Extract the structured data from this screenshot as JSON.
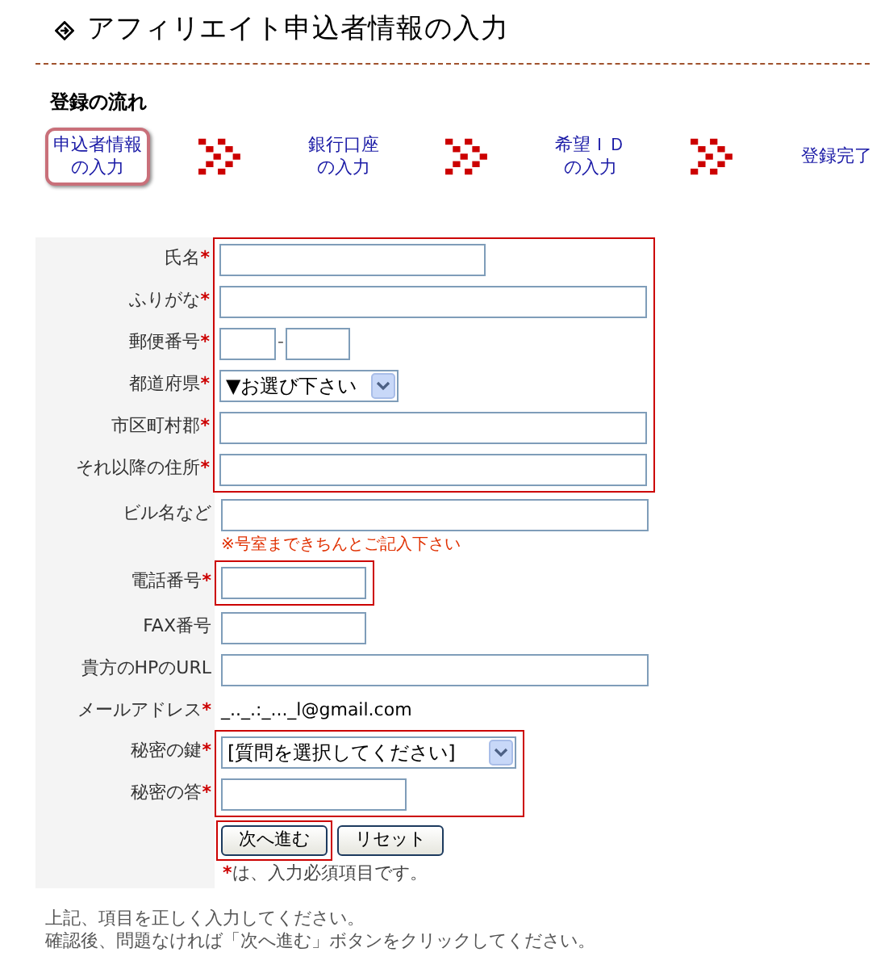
{
  "title": "アフィリエイト申込者情報の入力",
  "flow": {
    "heading": "登録の流れ",
    "steps": [
      {
        "label": "申込者情報",
        "label2": "の入力",
        "selected": true
      },
      {
        "label": "銀行口座",
        "label2": "の入力",
        "selected": false
      },
      {
        "label": "希望ＩＤ",
        "label2": "の入力",
        "selected": false
      },
      {
        "label": "登録完了",
        "selected": false
      }
    ]
  },
  "form": {
    "groups": [
      {
        "highlighted": true,
        "rows": [
          {
            "kind": "medium_text",
            "label": "氏名",
            "required_mark": "*"
          },
          {
            "kind": "long_text",
            "label": "ふりがな",
            "required_mark": "*"
          },
          {
            "kind": "zip",
            "label": "郵便番号",
            "required_mark": "*",
            "separator": "-"
          },
          {
            "kind": "prefecture_select",
            "label": "都道府県",
            "required_mark": "*",
            "value": "▼お選び下さい"
          },
          {
            "kind": "long_text",
            "label": "市区町村郡",
            "required_mark": "*"
          },
          {
            "kind": "long_text",
            "label": "それ以降の住所",
            "required_mark": "*"
          }
        ]
      },
      {
        "highlighted": false,
        "rows": [
          {
            "kind": "long_text",
            "label": "ビル名など",
            "hint": "※号室まできちんとご記入下さい"
          }
        ]
      },
      {
        "highlighted": true,
        "rows": [
          {
            "kind": "short_text",
            "label": "電話番号",
            "required_mark": "*"
          }
        ]
      },
      {
        "highlighted": false,
        "rows": [
          {
            "kind": "short_text",
            "label": "FAX番号"
          },
          {
            "kind": "long_text",
            "label": "貴方のHPのURL"
          },
          {
            "kind": "static",
            "label": "メールアドレス",
            "required_mark": "*",
            "value": "_.._.:_..._l@gmail.com"
          }
        ]
      },
      {
        "highlighted": true,
        "rows": [
          {
            "kind": "question_select",
            "label": "秘密の鍵",
            "required_mark": "*",
            "value": "[質問を選択してください]"
          },
          {
            "kind": "answer_text",
            "label": "秘密の答",
            "required_mark": "*"
          }
        ]
      }
    ],
    "buttons": [
      {
        "label": "次へ進む",
        "highlighted": true
      },
      {
        "label": "リセット",
        "highlighted": false
      }
    ],
    "required_note": {
      "mark": "*",
      "text": "は、入力必須項目です。"
    }
  },
  "footer": [
    "上記、項目を正しく入力してください。",
    "確認後、問題なければ「次へ進む」ボタンをクリックしてください。"
  ]
}
